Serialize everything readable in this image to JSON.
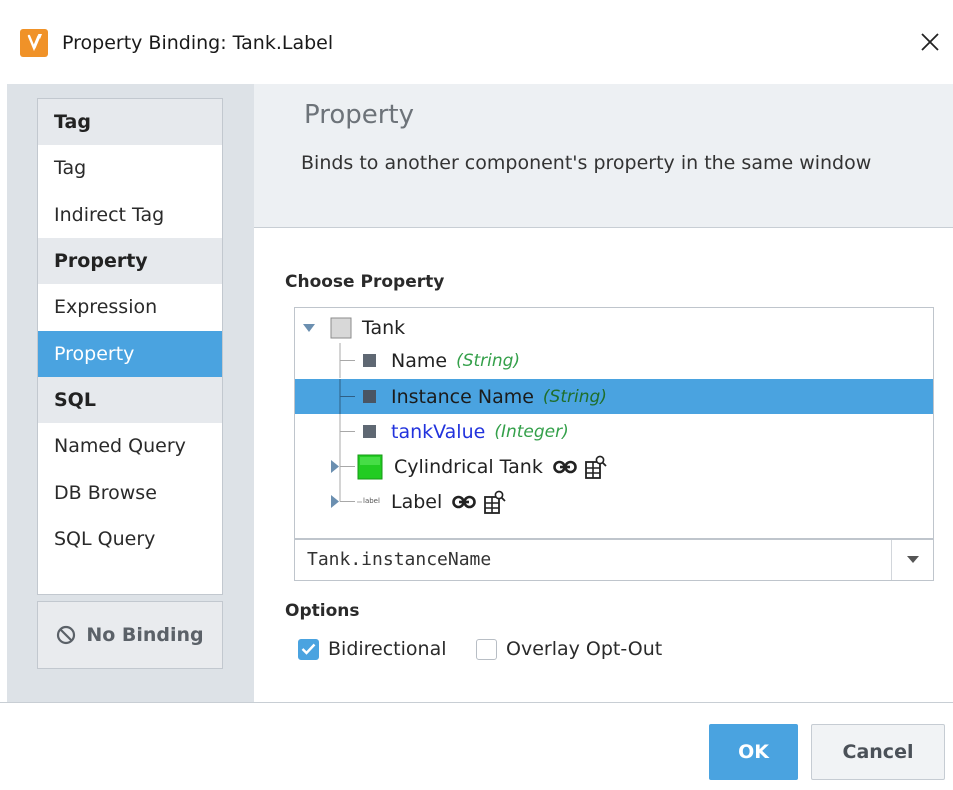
{
  "window": {
    "title": "Property Binding: Tank.Label",
    "app_icon": "ignition-designer-icon",
    "close_icon": "close-icon"
  },
  "binding_types": {
    "groups": [
      {
        "header": "Tag",
        "items": [
          "Tag",
          "Indirect Tag"
        ]
      },
      {
        "header": "Property",
        "items": [
          "Expression",
          "Property"
        ]
      },
      {
        "header": "SQL",
        "items": [
          "Named Query",
          "DB Browse",
          "SQL Query"
        ]
      }
    ],
    "selected": "Property",
    "no_binding_label": "No Binding"
  },
  "panel": {
    "title": "Property",
    "description": "Binds to another component's property in the same window"
  },
  "choose_property": {
    "heading": "Choose Property",
    "tree": [
      {
        "label": "Tank",
        "type": "",
        "level": 0,
        "expanded": true,
        "icon": "container-icon"
      },
      {
        "label": "Name",
        "type": "(String)",
        "level": 1,
        "icon": "property-icon"
      },
      {
        "label": "Instance Name",
        "type": "(String)",
        "level": 1,
        "icon": "property-icon",
        "selected": true
      },
      {
        "label": "tankValue",
        "type": "(Integer)",
        "level": 1,
        "icon": "property-icon",
        "highlight": true
      },
      {
        "label": "Cylindrical Tank",
        "type": "",
        "level": 1,
        "expanded": false,
        "icon": "cylindrical-tank-icon"
      },
      {
        "label": "Label",
        "type": "",
        "level": 1,
        "expanded": false,
        "icon": "label-component-icon"
      }
    ],
    "label_glyph": "label",
    "path_value": "Tank.instanceName"
  },
  "options": {
    "heading": "Options",
    "bidirectional_label": "Bidirectional",
    "bidirectional_checked": true,
    "overlay_label": "Overlay Opt-Out",
    "overlay_checked": false
  },
  "buttons": {
    "ok": "OK",
    "cancel": "Cancel"
  },
  "colors": {
    "accent": "#4aa3e0",
    "type_hint": "#34a04a",
    "highlight_text": "#2233dd",
    "tank_green": "#22cc22",
    "app_icon": "#f09228"
  }
}
